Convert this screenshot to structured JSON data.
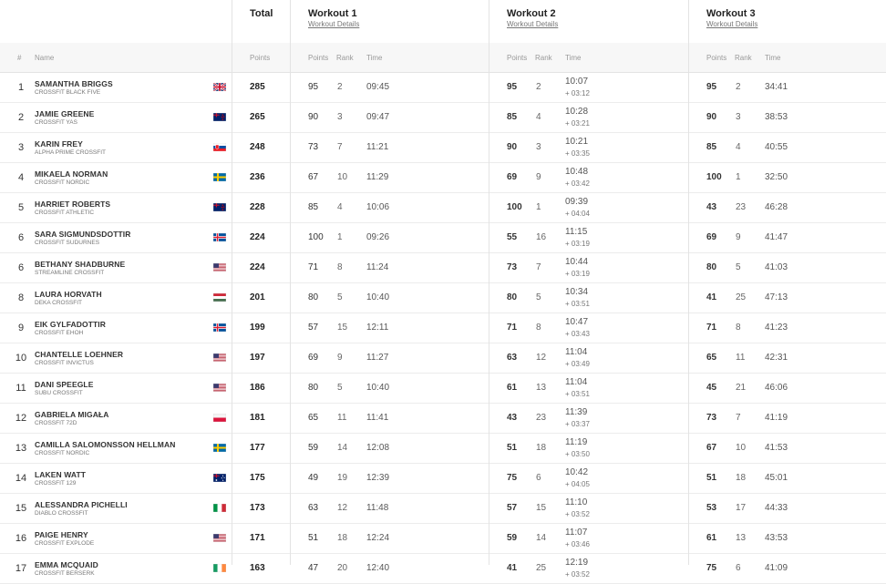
{
  "header": {
    "total": "Total",
    "workouts": [
      {
        "title": "Workout 1",
        "link": "Workout Details"
      },
      {
        "title": "Workout 2",
        "link": "Workout Details"
      },
      {
        "title": "Workout 3",
        "link": "Workout Details"
      }
    ]
  },
  "columns": {
    "rank": "#",
    "name": "Name",
    "points": "Points",
    "w_points": "Points",
    "w_rank": "Rank",
    "w_time": "Time"
  },
  "rows": [
    {
      "rank": "1",
      "name": "SAMANTHA BRIGGS",
      "affiliate": "CROSSFIT BLACK FIVE",
      "flag": "gb",
      "total": "285",
      "w": [
        {
          "p": "95",
          "r": "2",
          "t": "09:45",
          "d": ""
        },
        {
          "p": "95",
          "r": "2",
          "t": "10:07",
          "d": "+ 03:12"
        },
        {
          "p": "95",
          "r": "2",
          "t": "34:41",
          "d": ""
        }
      ]
    },
    {
      "rank": "2",
      "name": "JAMIE GREENE",
      "affiliate": "CROSSFIT YAS",
      "flag": "nz",
      "total": "265",
      "w": [
        {
          "p": "90",
          "r": "3",
          "t": "09:47",
          "d": ""
        },
        {
          "p": "85",
          "r": "4",
          "t": "10:28",
          "d": "+ 03:21"
        },
        {
          "p": "90",
          "r": "3",
          "t": "38:53",
          "d": ""
        }
      ]
    },
    {
      "rank": "3",
      "name": "KARIN FREY",
      "affiliate": "ALPHA PRIME CROSSFIT",
      "flag": "sk",
      "total": "248",
      "w": [
        {
          "p": "73",
          "r": "7",
          "t": "11:21",
          "d": ""
        },
        {
          "p": "90",
          "r": "3",
          "t": "10:21",
          "d": "+ 03:35"
        },
        {
          "p": "85",
          "r": "4",
          "t": "40:55",
          "d": ""
        }
      ]
    },
    {
      "rank": "4",
      "name": "MIKAELA NORMAN",
      "affiliate": "CROSSFIT NORDIC",
      "flag": "se",
      "total": "236",
      "w": [
        {
          "p": "67",
          "r": "10",
          "t": "11:29",
          "d": ""
        },
        {
          "p": "69",
          "r": "9",
          "t": "10:48",
          "d": "+ 03:42"
        },
        {
          "p": "100",
          "r": "1",
          "t": "32:50",
          "d": ""
        }
      ]
    },
    {
      "rank": "5",
      "name": "HARRIET ROBERTS",
      "affiliate": "CROSSFIT ATHLETIC",
      "flag": "nz",
      "total": "228",
      "w": [
        {
          "p": "85",
          "r": "4",
          "t": "10:06",
          "d": ""
        },
        {
          "p": "100",
          "r": "1",
          "t": "09:39",
          "d": "+ 04:04"
        },
        {
          "p": "43",
          "r": "23",
          "t": "46:28",
          "d": ""
        }
      ]
    },
    {
      "rank": "6",
      "name": "SARA SIGMUNDSDOTTIR",
      "affiliate": "CROSSFIT SUDURNES",
      "flag": "is",
      "total": "224",
      "w": [
        {
          "p": "100",
          "r": "1",
          "t": "09:26",
          "d": ""
        },
        {
          "p": "55",
          "r": "16",
          "t": "11:15",
          "d": "+ 03:19"
        },
        {
          "p": "69",
          "r": "9",
          "t": "41:47",
          "d": ""
        }
      ]
    },
    {
      "rank": "6",
      "name": "BETHANY SHADBURNE",
      "affiliate": "STREAMLINE CROSSFIT",
      "flag": "us",
      "total": "224",
      "w": [
        {
          "p": "71",
          "r": "8",
          "t": "11:24",
          "d": ""
        },
        {
          "p": "73",
          "r": "7",
          "t": "10:44",
          "d": "+ 03:19"
        },
        {
          "p": "80",
          "r": "5",
          "t": "41:03",
          "d": ""
        }
      ]
    },
    {
      "rank": "8",
      "name": "LAURA HORVATH",
      "affiliate": "DEKA CROSSFIT",
      "flag": "hu",
      "total": "201",
      "w": [
        {
          "p": "80",
          "r": "5",
          "t": "10:40",
          "d": ""
        },
        {
          "p": "80",
          "r": "5",
          "t": "10:34",
          "d": "+ 03:51"
        },
        {
          "p": "41",
          "r": "25",
          "t": "47:13",
          "d": ""
        }
      ]
    },
    {
      "rank": "9",
      "name": "EIK GYLFADOTTIR",
      "affiliate": "CROSSFIT EHOH",
      "flag": "is",
      "total": "199",
      "w": [
        {
          "p": "57",
          "r": "15",
          "t": "12:11",
          "d": ""
        },
        {
          "p": "71",
          "r": "8",
          "t": "10:47",
          "d": "+ 03:43"
        },
        {
          "p": "71",
          "r": "8",
          "t": "41:23",
          "d": ""
        }
      ]
    },
    {
      "rank": "10",
      "name": "CHANTELLE LOEHNER",
      "affiliate": "CROSSFIT INVICTUS",
      "flag": "us",
      "total": "197",
      "w": [
        {
          "p": "69",
          "r": "9",
          "t": "11:27",
          "d": ""
        },
        {
          "p": "63",
          "r": "12",
          "t": "11:04",
          "d": "+ 03:49"
        },
        {
          "p": "65",
          "r": "11",
          "t": "42:31",
          "d": ""
        }
      ]
    },
    {
      "rank": "11",
      "name": "DANI SPEEGLE",
      "affiliate": "SUBU CROSSFIT",
      "flag": "us",
      "total": "186",
      "w": [
        {
          "p": "80",
          "r": "5",
          "t": "10:40",
          "d": ""
        },
        {
          "p": "61",
          "r": "13",
          "t": "11:04",
          "d": "+ 03:51"
        },
        {
          "p": "45",
          "r": "21",
          "t": "46:06",
          "d": ""
        }
      ]
    },
    {
      "rank": "12",
      "name": "GABRIELA MIGAŁA",
      "affiliate": "CROSSFIT 72D",
      "flag": "pl",
      "total": "181",
      "w": [
        {
          "p": "65",
          "r": "11",
          "t": "11:41",
          "d": ""
        },
        {
          "p": "43",
          "r": "23",
          "t": "11:39",
          "d": "+ 03:37"
        },
        {
          "p": "73",
          "r": "7",
          "t": "41:19",
          "d": ""
        }
      ]
    },
    {
      "rank": "13",
      "name": "CAMILLA SALOMONSSON HELLMAN",
      "affiliate": "CROSSFIT NORDIC",
      "flag": "se",
      "total": "177",
      "w": [
        {
          "p": "59",
          "r": "14",
          "t": "12:08",
          "d": ""
        },
        {
          "p": "51",
          "r": "18",
          "t": "11:19",
          "d": "+ 03:50"
        },
        {
          "p": "67",
          "r": "10",
          "t": "41:53",
          "d": ""
        }
      ]
    },
    {
      "rank": "14",
      "name": "LAKEN WATT",
      "affiliate": "CROSSFIT 129",
      "flag": "au",
      "total": "175",
      "w": [
        {
          "p": "49",
          "r": "19",
          "t": "12:39",
          "d": ""
        },
        {
          "p": "75",
          "r": "6",
          "t": "10:42",
          "d": "+ 04:05"
        },
        {
          "p": "51",
          "r": "18",
          "t": "45:01",
          "d": ""
        }
      ]
    },
    {
      "rank": "15",
      "name": "ALESSANDRA PICHELLI",
      "affiliate": "DIABLO CROSSFIT",
      "flag": "it",
      "total": "173",
      "w": [
        {
          "p": "63",
          "r": "12",
          "t": "11:48",
          "d": ""
        },
        {
          "p": "57",
          "r": "15",
          "t": "11:10",
          "d": "+ 03:52"
        },
        {
          "p": "53",
          "r": "17",
          "t": "44:33",
          "d": ""
        }
      ]
    },
    {
      "rank": "16",
      "name": "PAIGE HENRY",
      "affiliate": "CROSSFIT EXPLODE",
      "flag": "us",
      "total": "171",
      "w": [
        {
          "p": "51",
          "r": "18",
          "t": "12:24",
          "d": ""
        },
        {
          "p": "59",
          "r": "14",
          "t": "11:07",
          "d": "+ 03:46"
        },
        {
          "p": "61",
          "r": "13",
          "t": "43:53",
          "d": ""
        }
      ]
    },
    {
      "rank": "17",
      "name": "EMMA MCQUAID",
      "affiliate": "CROSSFIT BERSERK",
      "flag": "ie",
      "total": "163",
      "w": [
        {
          "p": "47",
          "r": "20",
          "t": "12:40",
          "d": ""
        },
        {
          "p": "41",
          "r": "25",
          "t": "12:19",
          "d": "+ 03:52"
        },
        {
          "p": "75",
          "r": "6",
          "t": "41:09",
          "d": ""
        }
      ]
    }
  ]
}
